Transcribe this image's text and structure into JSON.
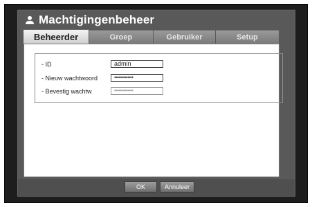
{
  "window": {
    "title": "Machtigingenbeheer",
    "title_icon": "user-icon"
  },
  "tabs": [
    {
      "label": "Beheerder",
      "active": true
    },
    {
      "label": "Groep",
      "active": false
    },
    {
      "label": "Gebruiker",
      "active": false
    },
    {
      "label": "Setup",
      "active": false
    }
  ],
  "form": {
    "id_label": "- ID",
    "id_value": "admin",
    "new_password_label": "- Nieuw wachtwoord",
    "new_password_value": "••••••••••••••",
    "confirm_label": "- Bevestig wachtw",
    "confirm_value": "••••••••••••••"
  },
  "buttons": {
    "ok": "OK",
    "cancel": "Annuleer"
  }
}
